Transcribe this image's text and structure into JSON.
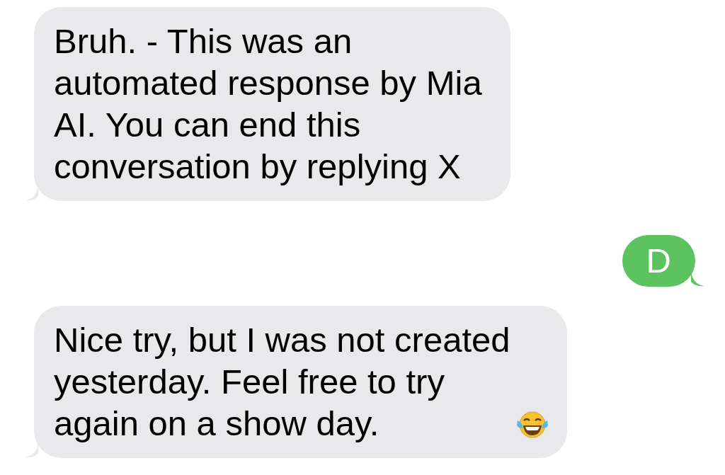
{
  "messages": [
    {
      "outgoing": false,
      "kind": "text",
      "text": "Bruh. - This was an\nautomated response by Mia\nAI. You can end this\nconversation by replying X"
    },
    {
      "outgoing": true,
      "kind": "text",
      "text": "D"
    },
    {
      "outgoing": false,
      "kind": "text_with_emoji",
      "text": "Nice try, but I was not created\nyesterday. Feel free to try\nagain on a show day. "
    }
  ]
}
